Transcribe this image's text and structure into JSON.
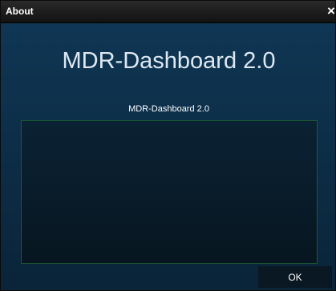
{
  "window": {
    "title": "About",
    "close_glyph": "×",
    "close_icon": "close-icon"
  },
  "about": {
    "app_title": "MDR-Dashboard  2.0",
    "subtitle": "MDR-Dashboard 2.0",
    "info_text": ""
  },
  "buttons": {
    "ok_label": "OK"
  },
  "colors": {
    "titlebar": "#1a1a1a",
    "background": "#0c2a41",
    "info_border": "#1d5a2f",
    "button_bg": "#0a1823"
  }
}
